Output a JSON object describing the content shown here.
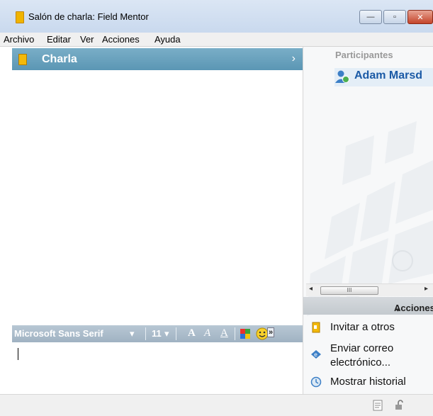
{
  "window": {
    "title": "Salón de charla: Field Mentor",
    "minimize_glyph": "—",
    "maximize_glyph": "▫",
    "close_glyph": "✕"
  },
  "menu": [
    "Archivo",
    "Editar",
    "Ver",
    "Acciones",
    "Ayuda"
  ],
  "chat": {
    "header_title": "Charla",
    "header_arrow": "›"
  },
  "format_toolbar": {
    "font_name": "Microsoft Sans Serif",
    "font_size": "11",
    "dropdown_glyph": "▾",
    "bold_label": "A",
    "italic_label": "A",
    "underline_label": "A",
    "overflow_glyph": "»"
  },
  "participants": {
    "label": "Participantes",
    "items": [
      {
        "name": "Adam Marsd"
      }
    ]
  },
  "scrollbar": {
    "left_arrow": "◂",
    "right_arrow": "▸",
    "grip": "III"
  },
  "actions": {
    "header": "Acciones",
    "chevron": "⌄",
    "items": [
      {
        "label": "Invitar a otros",
        "icon": "invite-icon"
      },
      {
        "label": "Enviar correo",
        "label2": "electrónico...",
        "icon": "email-icon"
      },
      {
        "label": "Mostrar historial",
        "icon": "history-icon"
      }
    ]
  },
  "colors": {
    "chat_header": "#5b96b4",
    "participant_name": "#1b5aa6",
    "format_toolbar": "#a0b2c2"
  }
}
